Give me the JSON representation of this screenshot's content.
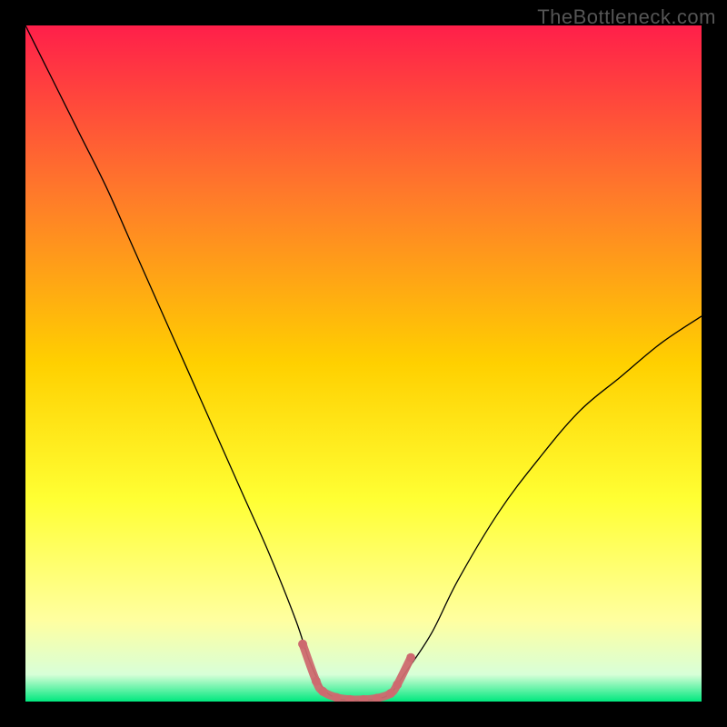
{
  "watermark": "TheBottleneck.com",
  "chart_data": {
    "type": "line",
    "title": "",
    "xlabel": "",
    "ylabel": "",
    "xlim": [
      0,
      100
    ],
    "ylim": [
      0,
      100
    ],
    "grid": false,
    "legend": false,
    "background_gradient": {
      "stops": [
        {
          "offset": 0.0,
          "color": "#ff1f4a"
        },
        {
          "offset": 0.25,
          "color": "#ff7a2a"
        },
        {
          "offset": 0.5,
          "color": "#ffd000"
        },
        {
          "offset": 0.7,
          "color": "#ffff33"
        },
        {
          "offset": 0.88,
          "color": "#ffffa0"
        },
        {
          "offset": 0.96,
          "color": "#d8ffd8"
        },
        {
          "offset": 1.0,
          "color": "#00e87e"
        }
      ]
    },
    "series": [
      {
        "name": "bottleneck-curve",
        "stroke": "#000000",
        "stroke_width": 1.3,
        "x": [
          0.0,
          4.0,
          8.0,
          12.0,
          16.0,
          20.0,
          24.0,
          28.0,
          32.0,
          36.0,
          40.0,
          42.0,
          44.0,
          46.0,
          48.0,
          50.0,
          52.0,
          54.0,
          56.0,
          60.0,
          64.0,
          70.0,
          76.0,
          82.0,
          88.0,
          94.0,
          100.0
        ],
        "y": [
          100.0,
          92.0,
          84.0,
          76.0,
          67.0,
          58.0,
          49.0,
          40.0,
          31.0,
          22.0,
          12.0,
          6.0,
          2.0,
          0.5,
          0.2,
          0.2,
          0.4,
          1.2,
          4.0,
          10.0,
          18.0,
          28.0,
          36.0,
          43.0,
          48.0,
          53.0,
          57.0
        ]
      },
      {
        "name": "bottleneck-zone-marker",
        "stroke": "#cd6a6f",
        "stroke_width": 9,
        "x": [
          41.0,
          43.0,
          44.0,
          46.0,
          48.0,
          50.0,
          52.0,
          54.0,
          55.0,
          57.0
        ],
        "y": [
          8.5,
          3.0,
          1.5,
          0.6,
          0.3,
          0.3,
          0.5,
          1.2,
          2.5,
          6.5
        ]
      }
    ]
  }
}
